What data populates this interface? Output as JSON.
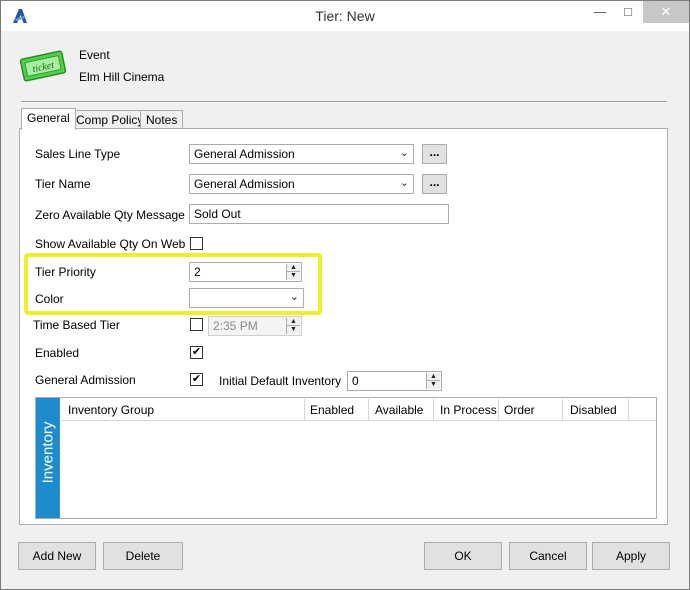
{
  "window": {
    "title": "Tier: New"
  },
  "header": {
    "event_label": "Event",
    "event_name": "Elm Hill Cinema",
    "ticket_text": "ticket"
  },
  "tabs": [
    {
      "label": "General"
    },
    {
      "label": "Comp Policy"
    },
    {
      "label": "Notes"
    }
  ],
  "form": {
    "sales_line_type": {
      "label": "Sales Line Type",
      "value": "General Admission"
    },
    "tier_name": {
      "label": "Tier Name",
      "value": "General Admission"
    },
    "zero_qty_message": {
      "label": "Zero Available Qty Message",
      "value": "Sold Out"
    },
    "show_qty_on_web": {
      "label": "Show Available Qty On Web",
      "checked": false
    },
    "tier_priority": {
      "label": "Tier Priority",
      "value": "2"
    },
    "color": {
      "label": "Color",
      "value": ""
    },
    "time_based_tier": {
      "label": "Time Based Tier",
      "checked": false,
      "time": "2:35 PM"
    },
    "enabled": {
      "label": "Enabled",
      "checked": true
    },
    "general_admission": {
      "label": "General Admission",
      "checked": true
    },
    "initial_default_inventory": {
      "label": "Initial Default Inventory",
      "value": "0"
    },
    "ellipsis": "..."
  },
  "inventory": {
    "side_label": "Inventory",
    "columns": [
      "Inventory Group",
      "Enabled",
      "Available",
      "In Process",
      "Order",
      "Disabled"
    ]
  },
  "footer": {
    "add_new": "Add New",
    "delete": "Delete",
    "ok": "OK",
    "cancel": "Cancel",
    "apply": "Apply"
  },
  "glyphs": {
    "check": "✔",
    "dropdown": "⌄",
    "up": "▲",
    "down": "▼"
  },
  "colors": {
    "highlight": "#f0f02a",
    "inventory_side": "#1e8ccc",
    "ticket_green": "#4fd14a"
  }
}
